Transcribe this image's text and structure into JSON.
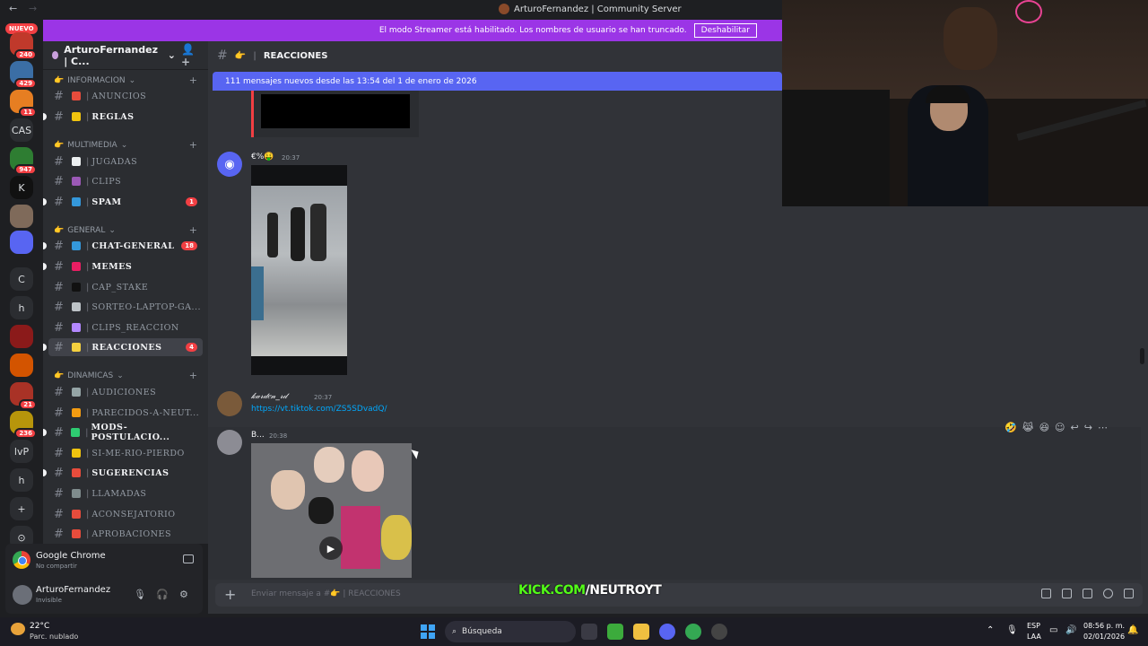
{
  "titlebar": {
    "back": "←",
    "forward": "→",
    "title": "ArturoFernandez | Community Server"
  },
  "streamer": {
    "text": "El modo Streamer está habilitado. Los nombres de usuario se han truncado.",
    "button": "Deshabilitar"
  },
  "rail": {
    "nuevo": "NUEVO",
    "items": [
      {
        "badge": "240"
      },
      {
        "badge": "429"
      },
      {
        "badge": "11"
      },
      {
        "label": "CAS"
      },
      {
        "badge": "947"
      },
      {
        "label": "K"
      },
      {
        "label": ""
      },
      {
        "label": ""
      },
      {
        "label": "C"
      },
      {
        "label": "h"
      },
      {
        "label": ""
      },
      {
        "label": ""
      },
      {
        "badge": "21"
      },
      {
        "badge": "236"
      },
      {
        "label": "lvP"
      },
      {
        "label": "h"
      },
      {
        "label": "+"
      },
      {
        "label": "⊙"
      }
    ]
  },
  "server": {
    "name": "ArturoFernandez | C...",
    "chevron": "⌄",
    "invite": "👤+"
  },
  "categories": [
    {
      "name": "INFORMACION",
      "emoji": "👉"
    },
    {
      "name": "MULTIMEDIA",
      "emoji": "👉"
    },
    {
      "name": "GENERAL",
      "emoji": "👉"
    },
    {
      "name": "DINAMICAS",
      "emoji": "👉"
    }
  ],
  "channels": [
    {
      "name": "ANUNCIOS",
      "icon": "📢",
      "color": "#e74c3c"
    },
    {
      "name": "REGLAS",
      "icon": "☑",
      "color": "#f1c40f",
      "unread": true
    },
    {
      "name": "JUGADAS",
      "icon": "⚽",
      "color": "#ecf0f1"
    },
    {
      "name": "CLIPS",
      "icon": "👥",
      "color": "#9b59b6"
    },
    {
      "name": "SPAM",
      "icon": "👾",
      "color": "#3498db",
      "unread": true,
      "count": "1"
    },
    {
      "name": "CHAT-GENERAL",
      "icon": "🌐",
      "color": "#3498db",
      "unread": true,
      "count": "18"
    },
    {
      "name": "MEMES",
      "icon": "😂",
      "color": "#e91e63",
      "unread": true
    },
    {
      "name": "CAP_STAKE",
      "icon": "⬛",
      "color": "#111111"
    },
    {
      "name": "SORTEO-LAPTOP-GA...",
      "icon": "💻",
      "color": "#bdc3c7"
    },
    {
      "name": "CLIPS_REACCION",
      "icon": "🟪",
      "color": "#b388ff"
    },
    {
      "name": "REACCIONES",
      "icon": "👉",
      "color": "#f4d03f",
      "active": true,
      "count": "4"
    },
    {
      "name": "AUDICIONES",
      "icon": "🔨",
      "color": "#95a5a6"
    },
    {
      "name": "PARECIDOS-A-NEUT...",
      "icon": "😂",
      "color": "#f39c12"
    },
    {
      "name": "MODS-POSTULACIO...",
      "icon": "🟩",
      "color": "#2ecc71",
      "unread": true
    },
    {
      "name": "SI-ME-RIO-PIERDO",
      "icon": "😂",
      "color": "#f1c40f"
    },
    {
      "name": "SUGERENCIAS",
      "icon": "🟥",
      "color": "#e74c3c",
      "unread": true
    },
    {
      "name": "LLAMADAS",
      "icon": "📱",
      "color": "#7f8c8d"
    },
    {
      "name": "ACONSEJATORIO",
      "icon": "🤬",
      "color": "#e74c3c"
    },
    {
      "name": "APROBACIONES",
      "icon": "📌",
      "color": "#e74c3c"
    }
  ],
  "activity": {
    "app": "Google Chrome",
    "status": "No compartir"
  },
  "user": {
    "name": "ArturoFernandez",
    "status": "Invisible"
  },
  "chat": {
    "channel": "REACCIONES",
    "channel_emoji": "👉",
    "new_messages": "111 mensajes nuevos desde las 13:54 del 1 de enero de 2026",
    "messages": [
      {
        "author": "€%🤑",
        "time": "20:37"
      },
      {
        "author": "𝓀𝒶𝓇𝒹𝑒𝓃_𝓇𝒹",
        "time": "20:37",
        "link": "https://vt.tiktok.com/ZS5SDvadQ/"
      },
      {
        "author": "B...",
        "time": "20:38"
      }
    ],
    "reactions": [
      "🤣",
      "😹",
      "😆",
      "☺",
      "↩",
      "↪",
      "⋯"
    ],
    "composer_placeholder": "Enviar mensaje a #👉 | REACCIONES",
    "overlay_prefix": "KICK.COM",
    "overlay_suffix": "/NEUTROYT"
  },
  "taskbar": {
    "temp": "22°C",
    "weather": "Parc. nublado",
    "search": "Búsqueda",
    "lang1": "ESP",
    "lang2": "LAA",
    "time": "08:56 p. m.",
    "date": "02/01/2026"
  }
}
